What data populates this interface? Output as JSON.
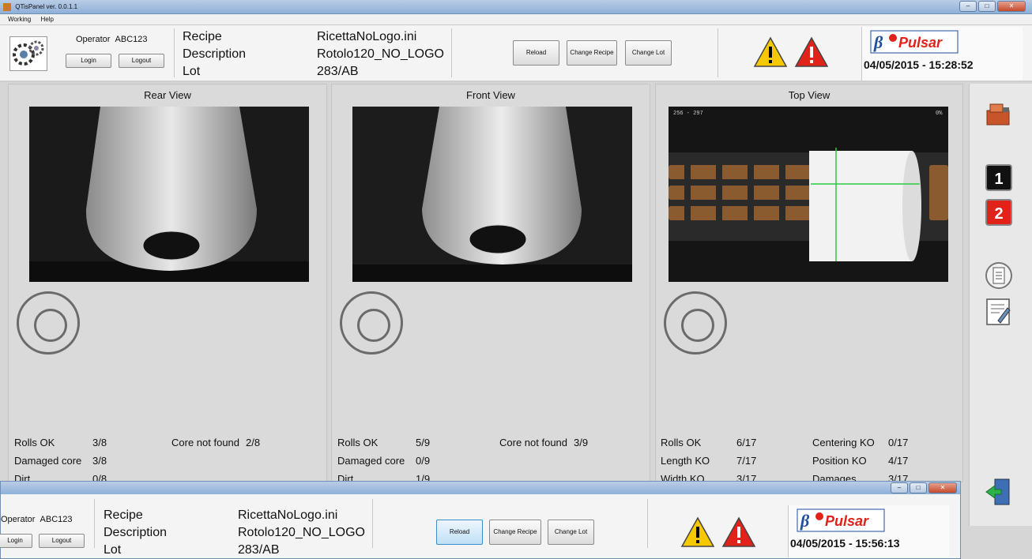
{
  "window": {
    "title": "QTisPanel ver. 0.0.1.1"
  },
  "menu": [
    "Working",
    "Help"
  ],
  "header": {
    "operator_label": "Operator",
    "operator_name": "ABC123",
    "login": "Login",
    "logout": "Logout",
    "recipe_label": "Recipe",
    "description_label": "Description",
    "lot_label": "Lot",
    "recipe_value": "RicettaNoLogo.ini",
    "description_value": "Rotolo120_NO_LOGO",
    "lot_value": "283/AB",
    "reload": "Reload",
    "change_recipe": "Change Recipe",
    "change_lot": "Change Lot",
    "brand": "Pulsar",
    "datetime": "04/05/2015 - 15:28:52"
  },
  "panels": {
    "rear": {
      "title": "Rear View",
      "stats": [
        {
          "label": "Rolls OK",
          "value": "3/8"
        },
        {
          "label": "Core not found",
          "value": "2/8"
        },
        {
          "label": "Damaged core",
          "value": "3/8"
        },
        {
          "label": "Dirt",
          "value": "0/8"
        }
      ]
    },
    "front": {
      "title": "Front View",
      "stats": [
        {
          "label": "Rolls OK",
          "value": "5/9"
        },
        {
          "label": "Core not found",
          "value": "3/9"
        },
        {
          "label": "Damaged core",
          "value": "0/9"
        },
        {
          "label": "Dirt",
          "value": "1/9"
        }
      ]
    },
    "top": {
      "title": "Top View",
      "overlay_left": "256 - 297",
      "overlay_right": "0%",
      "stats": [
        {
          "label": "Rolls OK",
          "value": "6/17"
        },
        {
          "label": "Centering KO",
          "value": "0/17"
        },
        {
          "label": "Length KO",
          "value": "7/17"
        },
        {
          "label": "Position KO",
          "value": "4/17"
        },
        {
          "label": "Width KO",
          "value": "3/17"
        },
        {
          "label": "Damages",
          "value": "3/17"
        }
      ]
    }
  },
  "sidebar": {
    "num1": "1",
    "num2": "2"
  },
  "window2": {
    "operator_label": "Operator",
    "operator_name": "ABC123",
    "login": "Login",
    "logout": "Logout",
    "recipe_label": "Recipe",
    "description_label": "Description",
    "lot_label": "Lot",
    "recipe_value": "RicettaNoLogo.ini",
    "description_value": "Rotolo120_NO_LOGO",
    "lot_value": "283/AB",
    "reload": "Reload",
    "change_recipe": "Change Recipe",
    "change_lot": "Change Lot",
    "brand": "Pulsar",
    "datetime": "04/05/2015 - 15:56:13"
  },
  "colors": {
    "accent_red": "#e0221b",
    "warning_yellow": "#f6c800",
    "brand_blue": "#1f4f9e"
  }
}
